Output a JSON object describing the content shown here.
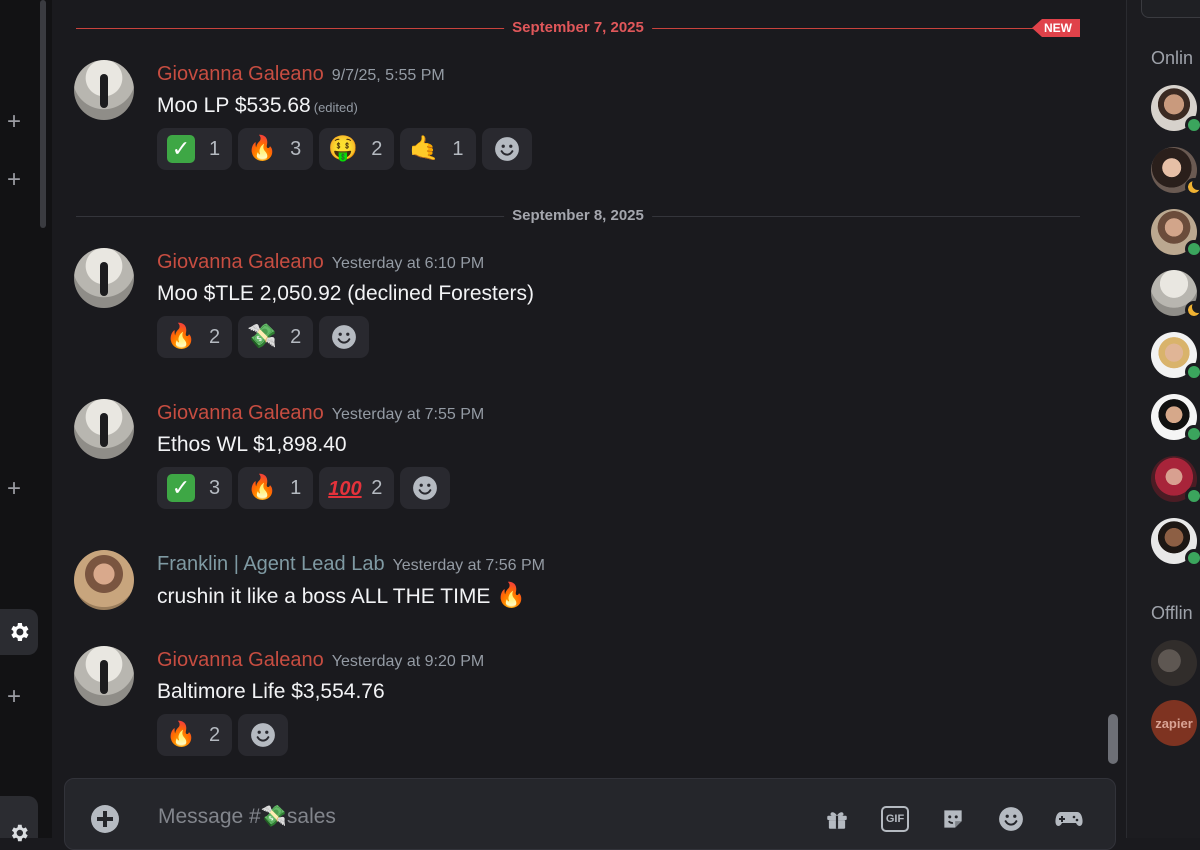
{
  "dividers": {
    "first": {
      "label": "September 7, 2025",
      "badge": "NEW"
    },
    "second": {
      "label": "September 8, 2025"
    }
  },
  "messages": [
    {
      "author": "Giovanna Galeano",
      "timestamp": "9/7/25, 5:55 PM",
      "text": "Moo LP $535.68",
      "edited": "(edited)",
      "reactions": [
        {
          "emoji": "check-mark-button",
          "glyph": "✓",
          "count": "1"
        },
        {
          "emoji": "fire",
          "glyph": "🔥",
          "count": "3"
        },
        {
          "emoji": "money-mouth-face",
          "glyph": "🤑",
          "count": "2"
        },
        {
          "emoji": "call-me-hand",
          "glyph": "🤙",
          "count": "1"
        }
      ]
    },
    {
      "author": "Giovanna Galeano",
      "timestamp": "Yesterday at 6:10 PM",
      "text": "Moo $TLE 2,050.92 (declined Foresters)",
      "reactions": [
        {
          "emoji": "fire",
          "glyph": "🔥",
          "count": "2"
        },
        {
          "emoji": "money-with-wings",
          "glyph": "💸",
          "count": "2"
        }
      ]
    },
    {
      "author": "Giovanna Galeano",
      "timestamp": "Yesterday at 7:55 PM",
      "text": "Ethos WL $1,898.40",
      "reactions": [
        {
          "emoji": "check-mark-button",
          "glyph": "✓",
          "count": "3"
        },
        {
          "emoji": "fire",
          "glyph": "🔥",
          "count": "1"
        },
        {
          "emoji": "hundred-points",
          "glyph": "100",
          "count": "2"
        }
      ]
    },
    {
      "author": "Franklin | Agent Lead Lab",
      "timestamp": "Yesterday at 7:56 PM",
      "text": "crushin it like a boss ALL THE TIME",
      "inline_emoji": "🔥"
    },
    {
      "author": "Giovanna Galeano",
      "timestamp": "Yesterday at 9:20 PM",
      "text": "Baltimore Life $3,554.76",
      "reactions": [
        {
          "emoji": "fire",
          "glyph": "🔥",
          "count": "2"
        }
      ]
    }
  ],
  "composer": {
    "placeholder_prefix": "Message #",
    "channel_emoji": "💸",
    "channel": "sales",
    "gif_label": "GIF"
  },
  "members": {
    "online_header": "Onlin",
    "offline_header": "Offlin",
    "offline_logo_text": "zapier"
  },
  "colors": {
    "author_giovanna": "#c74d41",
    "author_franklin": "#7f9aa3",
    "new_divider": "#e0424a",
    "online_status": "#3ba55d",
    "idle_status": "#f0b232"
  }
}
